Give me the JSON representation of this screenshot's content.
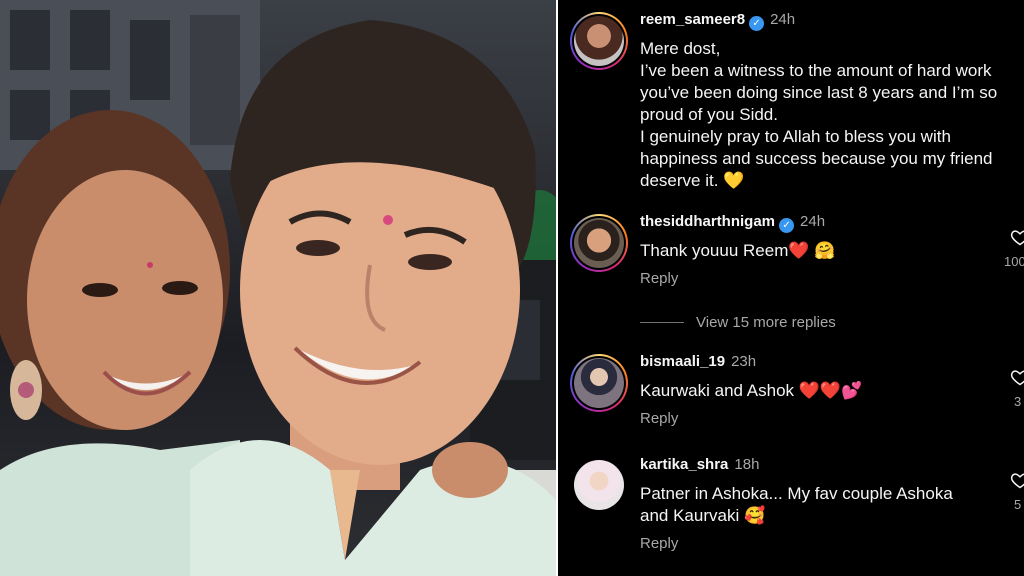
{
  "post": {
    "username": "reem_sameer8",
    "time": "24h",
    "caption": "Mere dost,\nI’ve been a witness to the amount of hard work\nyou’ve been doing since last 8 years and I’m so\nproud of you Sidd.\nI genuinely pray to Allah to bless you with\nhappiness and success because you my friend\ndeserve it. 💛"
  },
  "comments": [
    {
      "username": "thesiddharthnigam",
      "time": "24h",
      "text": "Thank youuu Reem❤️ 🤗",
      "reply_label": "Reply",
      "likes": "100",
      "view_more": "View 15 more replies"
    },
    {
      "username": "bismaali_19",
      "time": "23h",
      "text": "Kaurwaki and Ashok ❤️❤️💕",
      "reply_label": "Reply",
      "likes": "3"
    },
    {
      "username": "kartika_shra",
      "time": "18h",
      "text": "Patner in Ashoka... My fav couple Ashoka\nand Kaurvaki 🥰",
      "reply_label": "Reply",
      "likes": "5"
    }
  ],
  "colors": {
    "background": "#000000",
    "secondary_text": "#a8a8a8",
    "verified": "#3897f0"
  },
  "icons": {
    "verified": "verified-badge-icon",
    "like": "heart-outline-icon"
  }
}
